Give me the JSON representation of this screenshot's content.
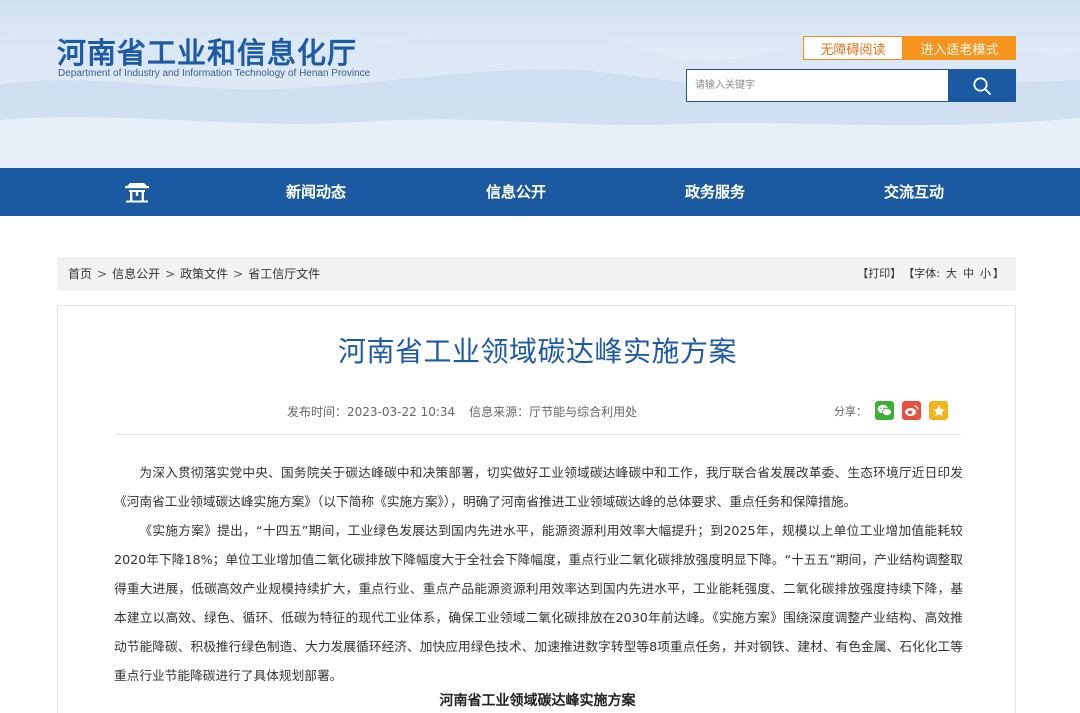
{
  "header": {
    "title_cn": "河南省工业和信息化厅",
    "title_en": "Department of Industry and Information Technology of Henan Province",
    "accessibility_label": "无障碍阅读",
    "elder_mode_label": "进入适老模式",
    "search": {
      "placeholder": "请输入关键字",
      "icon": "search-icon"
    }
  },
  "nav": {
    "home_icon": "home-pavilion-icon",
    "items": [
      "新闻动态",
      "信息公开",
      "政务服务",
      "交流互动"
    ]
  },
  "breadcrumb": {
    "items": [
      "首页",
      "信息公开",
      "政策文件",
      "省工信厅文件"
    ],
    "separator": ">"
  },
  "tools": {
    "print": "【打印】",
    "font_label": "【字体:",
    "font_large": "大",
    "font_medium": "中",
    "font_small": "小",
    "font_close": "】"
  },
  "article": {
    "title": "河南省工业领域碳达峰实施方案",
    "publish_time": "发布时间：2023-03-22 10:34",
    "source": "信息来源：厅节能与综合利用处",
    "share_label": "分享：",
    "share_icons": [
      "wechat-icon",
      "weibo-icon",
      "qzone-icon"
    ],
    "paragraphs": [
      "为深入贯彻落实党中央、国务院关于碳达峰碳中和决策部署，切实做好工业领域碳达峰碳中和工作，我厅联合省发展改革委、生态环境厅近日印发《河南省工业领域碳达峰实施方案》（以下简称《实施方案》），明确了河南省推进工业领域碳达峰的总体要求、重点任务和保障措施。",
      "《实施方案》提出，“十四五”期间，工业绿色发展达到国内先进水平，能源资源利用效率大幅提升；到2025年，规模以上单位工业增加值能耗较2020年下降18%；单位工业增加值二氧化碳排放下降幅度大于全社会下降幅度，重点行业二氧化碳排放强度明显下降。“十五五”期间，产业结构调整取得重大进展，低碳高效产业规模持续扩大，重点行业、重点产品能源资源利用效率达到国内先进水平，工业能耗强度、二氧化碳排放强度持续下降，基本建立以高效、绿色、循环、低碳为特征的现代工业体系，确保工业领域二氧化碳排放在2030年前达峰。《实施方案》围绕深度调整产业结构、高效推动节能降碳、积极推行绿色制造、大力发展循环经济、加快应用绿色技术、加速推进数字转型等8项重点任务，并对钢铁、建材、有色金属、石化化工等重点行业节能降碳进行了具体规划部署。"
    ],
    "subheading": "河南省工业领域碳达峰实施方案"
  },
  "colors": {
    "brand_blue": "#1b5aa0",
    "accent_orange": "#f7941d",
    "wechat_green": "#3cb034",
    "weibo_red": "#e6513f",
    "qzone_yellow": "#f5b21b"
  }
}
